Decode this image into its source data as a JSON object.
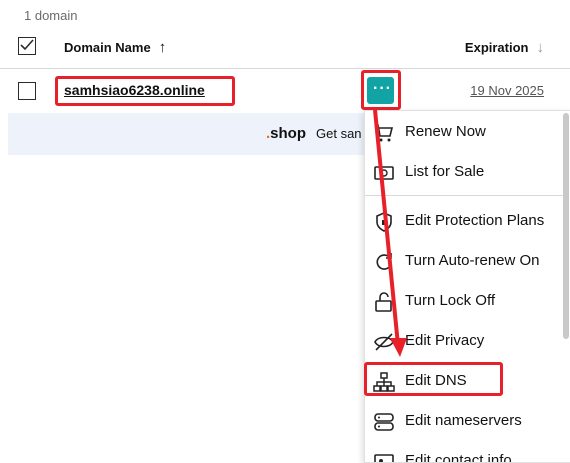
{
  "summary": {
    "count": "1 domain"
  },
  "table": {
    "columns": {
      "name": "Domain Name",
      "name_sort": "↑",
      "expiration": "Expiration",
      "expiration_sort": "↓"
    },
    "rows": [
      {
        "domain": "samhsiao6238.online",
        "expiration": "19 Nov 2025"
      }
    ]
  },
  "actions": {
    "more_label": "···"
  },
  "promo": {
    "brand": "shop",
    "text": "Get san"
  },
  "menu": {
    "items": [
      {
        "label": "Renew Now",
        "icon": "cart-icon"
      },
      {
        "label": "List for Sale",
        "icon": "money-icon"
      },
      {
        "label": "Edit Protection Plans",
        "icon": "shield-icon"
      },
      {
        "label": "Turn Auto-renew On",
        "icon": "refresh-icon"
      },
      {
        "label": "Turn Lock Off",
        "icon": "unlock-icon"
      },
      {
        "label": "Edit Privacy",
        "icon": "privacy-eye-icon"
      },
      {
        "label": "Edit DNS",
        "icon": "dns-hierarchy-icon"
      },
      {
        "label": "Edit nameservers",
        "icon": "server-icon"
      },
      {
        "label": "Edit contact info",
        "icon": "contact-icon"
      }
    ]
  },
  "colors": {
    "accent": "#12a4a4",
    "annotation": "#e8202a",
    "promo_bg": "#eef3fb"
  }
}
